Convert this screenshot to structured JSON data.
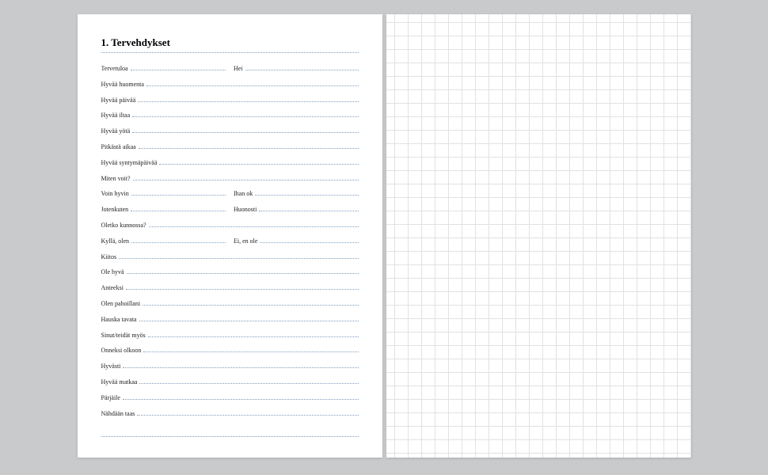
{
  "title": "1. Tervehdykset",
  "rows": [
    {
      "type": "split",
      "left": "Tervetuloa",
      "right": "Hei"
    },
    {
      "type": "full",
      "text": "Hyvää huomenta"
    },
    {
      "type": "full",
      "text": "Hyvää päivää"
    },
    {
      "type": "full",
      "text": "Hyvää iltaa"
    },
    {
      "type": "full",
      "text": "Hyvää yötä"
    },
    {
      "type": "full",
      "text": "Pitkästä aikaa"
    },
    {
      "type": "full",
      "text": "Hyvää syntymäpäivää"
    },
    {
      "type": "full",
      "text": "Miten voit?"
    },
    {
      "type": "split",
      "left": "Voin hyvin",
      "right": "Ihan ok"
    },
    {
      "type": "split",
      "left": "Jotenkuten",
      "right": "Huonosti"
    },
    {
      "type": "full",
      "text": "Oletko kunnossa?"
    },
    {
      "type": "split",
      "left": "Kyllä, olen",
      "right": "Ei, en ole"
    },
    {
      "type": "full",
      "text": "Kiitos"
    },
    {
      "type": "full",
      "text": "Ole hyvä"
    },
    {
      "type": "full",
      "text": "Anteeksi"
    },
    {
      "type": "full",
      "text": "Olen pahoillani"
    },
    {
      "type": "full",
      "text": "Hauska tavata"
    },
    {
      "type": "full",
      "text": "Sinut/teidät myös"
    },
    {
      "type": "full",
      "text": "Onneksi olkoon"
    },
    {
      "type": "full",
      "text": "Hyvästi"
    },
    {
      "type": "full",
      "text": "Hyvää matkaa"
    },
    {
      "type": "full",
      "text": "Pärjäile"
    },
    {
      "type": "full",
      "text": "Nähdään taas"
    }
  ]
}
